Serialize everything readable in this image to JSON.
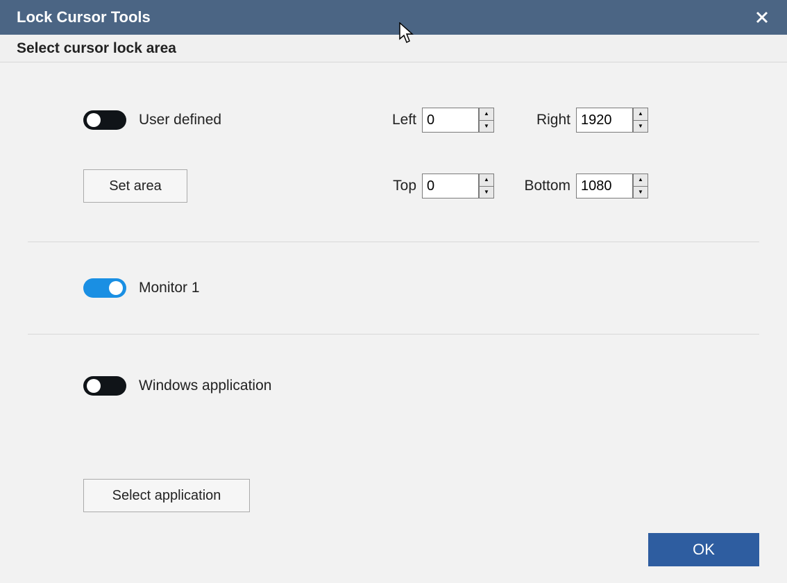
{
  "titlebar": {
    "title": "Lock Cursor Tools"
  },
  "subheader": "Select cursor lock area",
  "user_defined": {
    "toggle_label": "User defined",
    "toggle_on": false,
    "set_area_label": "Set area",
    "fields": {
      "left": {
        "label": "Left",
        "value": "0"
      },
      "right": {
        "label": "Right",
        "value": "1920"
      },
      "top": {
        "label": "Top",
        "value": "0"
      },
      "bottom": {
        "label": "Bottom",
        "value": "1080"
      }
    }
  },
  "monitor": {
    "toggle_label": "Monitor 1",
    "toggle_on": true
  },
  "app": {
    "toggle_label": "Windows application",
    "toggle_on": false,
    "select_label": "Select application"
  },
  "ok_label": "OK"
}
